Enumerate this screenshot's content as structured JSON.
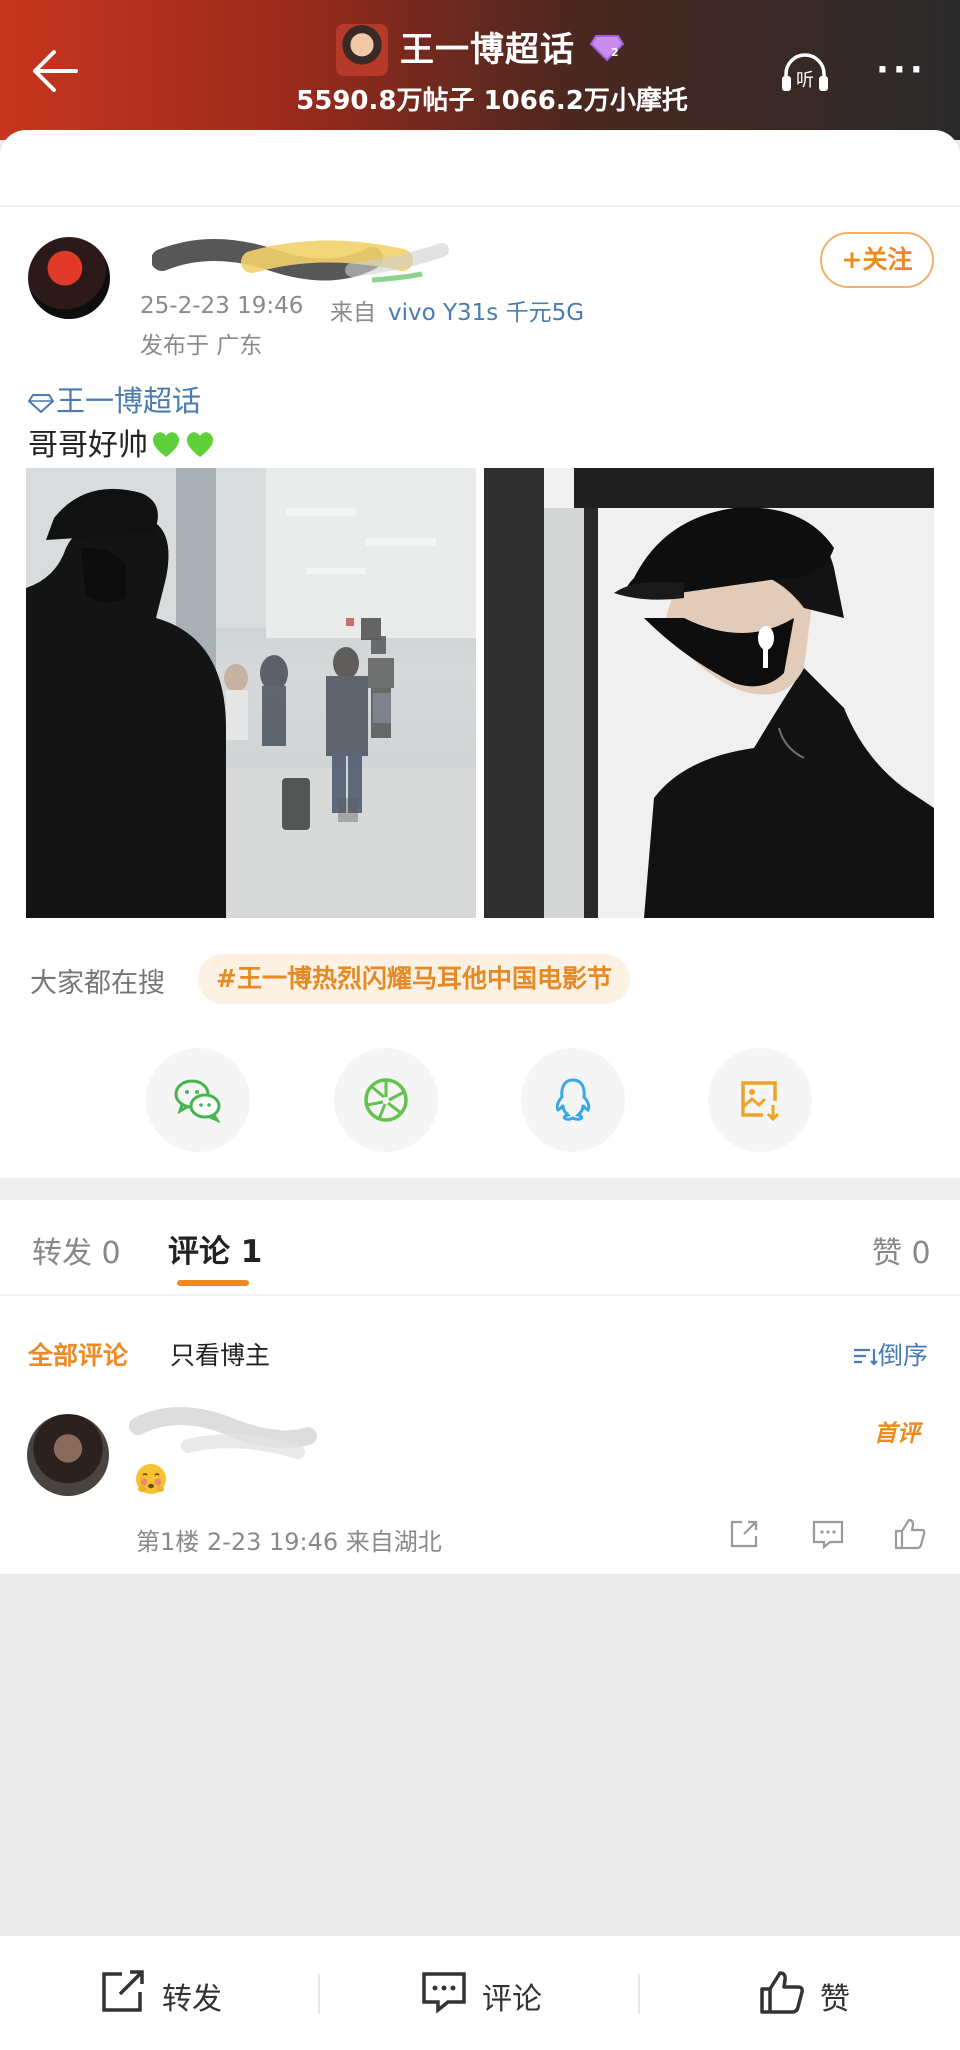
{
  "header": {
    "topic_title": "王一博超话",
    "level": "2",
    "stats": "5590.8万帖子 1066.2万小摩托",
    "listen_label": "听",
    "more_label": "···"
  },
  "post": {
    "time": "25-2-23 19:46",
    "source_prefix": "来自",
    "device": "vivo Y31s 千元5G",
    "location": "发布于 广东",
    "follow_label": "+关注",
    "topic_link": "王一博超话",
    "text": "哥哥好帅"
  },
  "search": {
    "label": "大家都在搜",
    "tag": "#王一博热烈闪耀马耳他中国电影节"
  },
  "share_targets": [
    "wechat-icon",
    "moments-icon",
    "qq-icon",
    "save-image-icon"
  ],
  "tabs": {
    "repost": "转发 0",
    "comment": "评论 1",
    "like": "赞 0"
  },
  "comments": {
    "filter_all": "全部评论",
    "filter_author": "只看博主",
    "sort": "倒序",
    "items": [
      {
        "badge": "首评",
        "meta": "第1楼 2-23 19:46 来自湖北"
      }
    ]
  },
  "bottom_bar": {
    "repost": "转发",
    "comment": "评论",
    "like": "赞"
  }
}
